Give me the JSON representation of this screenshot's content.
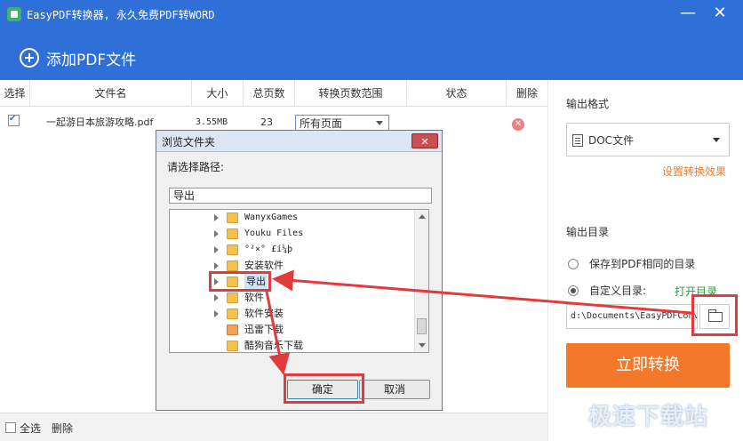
{
  "window": {
    "title": "EasyPDF转换器, 永久免费PDF转WORD",
    "minimize_glyph": "—",
    "close_glyph": "✕"
  },
  "header": {
    "add_pdf_label": "添加PDF文件",
    "add_icon": "plus-circle-icon"
  },
  "table": {
    "columns": [
      "选择",
      "文件名",
      "大小",
      "总页数",
      "转换页数范围",
      "状态",
      "删除"
    ],
    "rows": [
      {
        "selected": true,
        "filename": "一起游日本旅游攻略.pdf",
        "size": "3.55MB",
        "pages": "23",
        "range": "所有页面",
        "status": "",
        "delete_icon": "close-circle-icon"
      }
    ]
  },
  "bottom_bar": {
    "select_all_label": "全选",
    "delete_label": "删除"
  },
  "right_panel": {
    "output_format_label": "输出格式",
    "format_value": "DOC文件",
    "settings_link": "设置转换效果",
    "output_dir_label": "输出目录",
    "option_same_dir": "保存到PDF相同的目录",
    "option_custom_dir": "自定义目录:",
    "open_dir_link": "打开目录",
    "path_value": "d:\\Documents\\EasyPDFConv",
    "convert_button": "立即转换"
  },
  "dialog": {
    "title": "浏览文件夹",
    "close_glyph": "✕",
    "prompt": "请选择路径:",
    "path_value": "导出",
    "tree_items": [
      {
        "label": "WanyxGames",
        "mono": true,
        "expandable": true,
        "selected": false,
        "special": false
      },
      {
        "label": "Youku Files",
        "mono": true,
        "expandable": true,
        "selected": false,
        "special": false
      },
      {
        "label": "°²×° £í¼þ",
        "mono": true,
        "expandable": true,
        "selected": false,
        "special": false
      },
      {
        "label": "安装软件",
        "mono": false,
        "expandable": true,
        "selected": false,
        "special": false
      },
      {
        "label": "导出",
        "mono": false,
        "expandable": true,
        "selected": true,
        "special": false
      },
      {
        "label": "软件",
        "mono": false,
        "expandable": true,
        "selected": false,
        "special": false
      },
      {
        "label": "软件安装",
        "mono": false,
        "expandable": true,
        "selected": false,
        "special": false
      },
      {
        "label": "迅雷下载",
        "mono": false,
        "expandable": false,
        "selected": false,
        "special": true
      },
      {
        "label": "酷狗音乐下载",
        "mono": false,
        "expandable": false,
        "selected": false,
        "special": false
      }
    ],
    "ok_button": "确定",
    "cancel_button": "取消"
  },
  "watermark": "极速下载站",
  "colors": {
    "titlebar": "#2e6fd8",
    "accent_orange": "#f3782a",
    "link_green": "#2a9d3a",
    "annotation_red": "#e23b3b"
  }
}
